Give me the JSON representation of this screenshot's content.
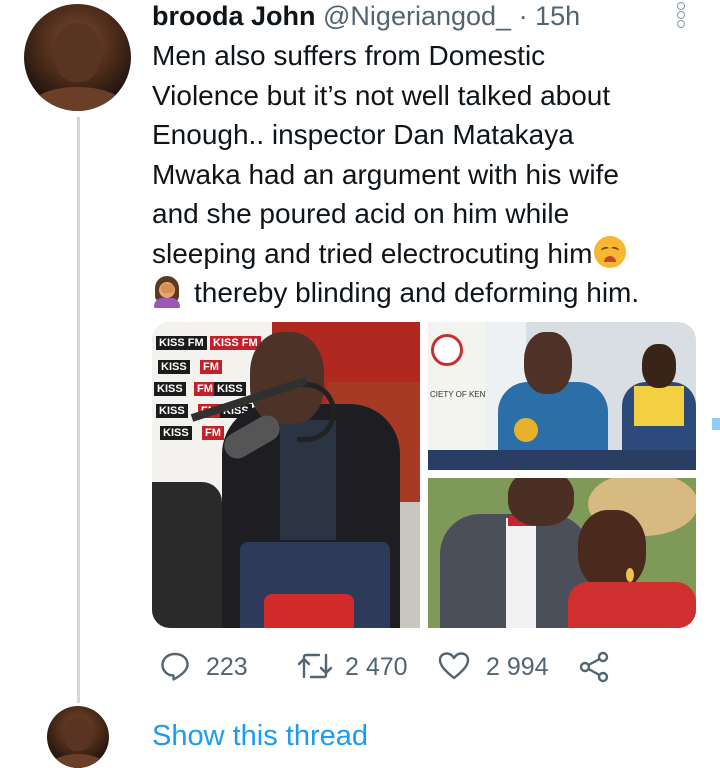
{
  "tweet": {
    "author_name": "brooda John",
    "handle": "@Nigeriangod_",
    "separator": "·",
    "time": "15h",
    "text_lines": [
      "Men also suffers from Domestic",
      "Violence but it’s not well talked about",
      "Enough.. inspector Dan Matakaya",
      "Mwaka had an argument with his wife",
      "and she poured acid on him while",
      "sleeping and tried electrocuting him",
      "thereby blinding and deforming him."
    ],
    "emoji": [
      "tired-face-emoji",
      "woman-facepalming-emoji"
    ],
    "media": {
      "image_count": 3,
      "visible_signage": {
        "radio_logo": [
          "KISS FM",
          "KISS",
          "FM"
        ],
        "poster_text": "CIETY OF KENYA"
      }
    },
    "actions": {
      "replies": "223",
      "retweets": "2 470",
      "likes": "2 994"
    }
  },
  "thread": {
    "show_label": "Show this thread"
  },
  "colors": {
    "link": "#1d9bf0",
    "muted": "#536471",
    "text": "#0f1419",
    "thread_line": "#cfd9de"
  },
  "icons": [
    "reply-icon",
    "retweet-icon",
    "like-icon",
    "share-icon",
    "more-options-icon"
  ]
}
